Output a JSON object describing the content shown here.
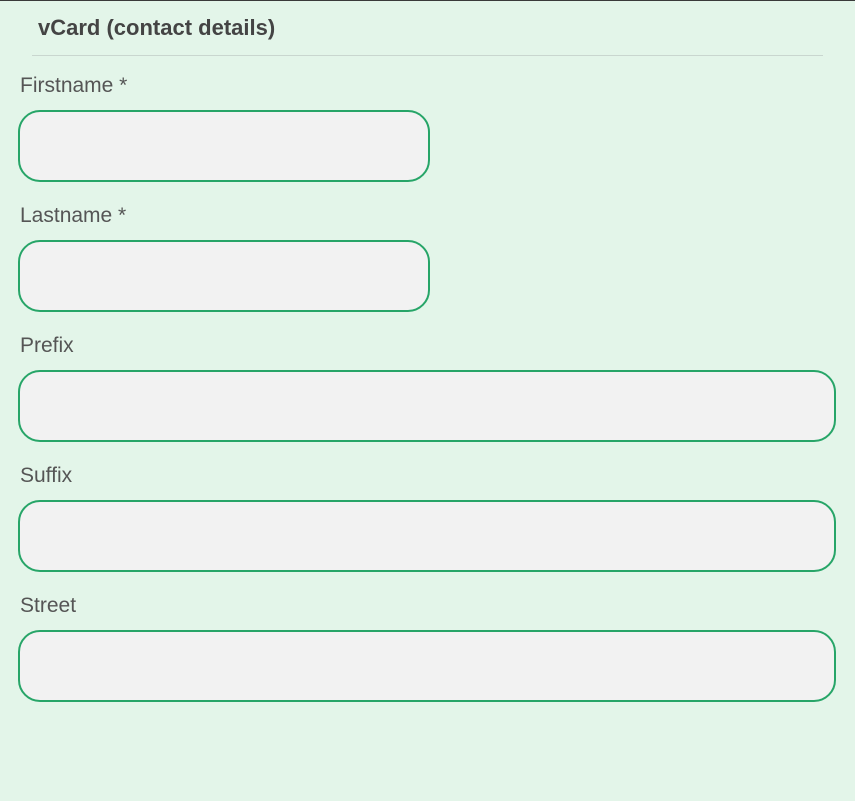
{
  "section": {
    "title": "vCard (contact details)"
  },
  "fields": {
    "firstname": {
      "label": "Firstname *",
      "value": ""
    },
    "lastname": {
      "label": "Lastname *",
      "value": ""
    },
    "prefix": {
      "label": "Prefix",
      "value": ""
    },
    "suffix": {
      "label": "Suffix",
      "value": ""
    },
    "street": {
      "label": "Street",
      "value": ""
    }
  }
}
